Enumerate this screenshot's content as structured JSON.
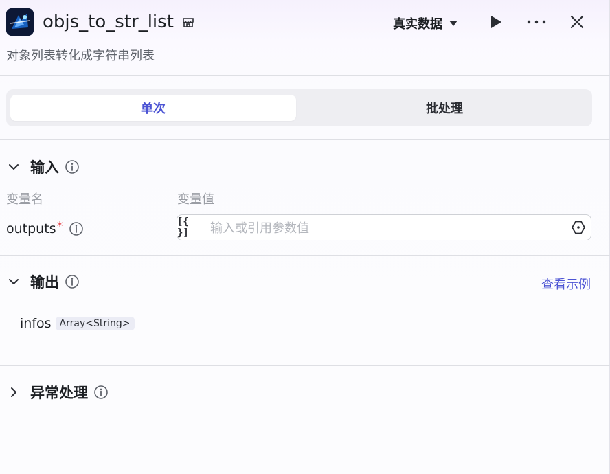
{
  "header": {
    "title": "objs_to_str_list",
    "subtitle": "对象列表转化成字符串列表",
    "data_source": "真实数据"
  },
  "tabs": [
    {
      "label": "单次",
      "active": true
    },
    {
      "label": "批处理",
      "active": false
    }
  ],
  "input": {
    "title": "输入",
    "col_name": "变量名",
    "col_value": "变量值",
    "param": {
      "name": "outputs",
      "required_mark": "*",
      "placeholder": "输入或引用参数值",
      "brace_label": "[{ }]"
    }
  },
  "output": {
    "title": "输出",
    "example_link": "查看示例",
    "field": {
      "name": "infos",
      "type": "Array<String>"
    }
  },
  "exception": {
    "title": "异常处理"
  },
  "colors": {
    "accent": "#4c54d4",
    "required": "#e5484d"
  },
  "icons": [
    "app-logo-icon",
    "store-badge-icon",
    "caret-down-icon",
    "play-icon",
    "more-icon",
    "close-icon",
    "chevron-down-icon",
    "chevron-right-icon",
    "info-icon",
    "variable-reference-icon"
  ]
}
